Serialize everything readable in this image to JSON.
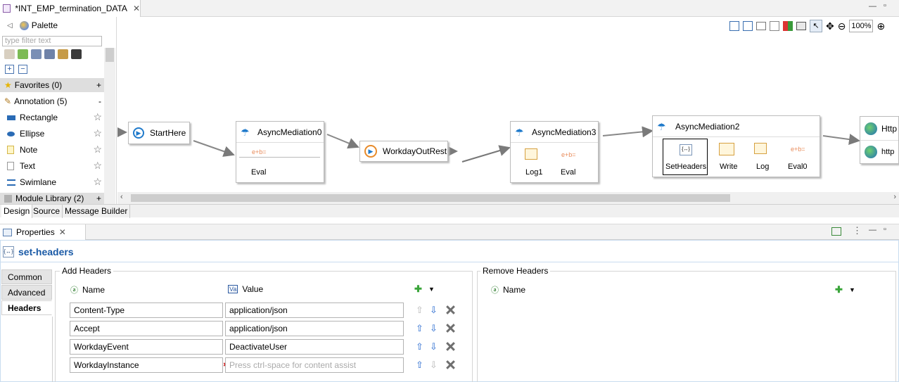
{
  "editor": {
    "tab_title": "*INT_EMP_termination_DATA",
    "tab_close": "✕",
    "minimize": "—",
    "maximize": "▫"
  },
  "palette": {
    "title": "Palette",
    "filter_placeholder": "type filter text",
    "sections": {
      "favorites": {
        "label": "Favorites (0)",
        "toggle": "+"
      },
      "annotation": {
        "label": "Annotation (5)",
        "toggle": "-"
      },
      "module_library": {
        "label": "Module Library (2)",
        "toggle": "+"
      }
    },
    "items": [
      {
        "label": "Rectangle",
        "icon": "rectangle-icon"
      },
      {
        "label": "Ellipse",
        "icon": "ellipse-icon"
      },
      {
        "label": "Note",
        "icon": "note-icon"
      },
      {
        "label": "Text",
        "icon": "text-icon"
      },
      {
        "label": "Swimlane",
        "icon": "swimlane-icon"
      }
    ],
    "star": "☆"
  },
  "toolbar": {
    "zoom": "100%"
  },
  "canvas": {
    "nodes": {
      "start": "StartHere",
      "am0": {
        "title": "AsyncMediation0",
        "steps": [
          "Eval"
        ]
      },
      "workday_out": "WorkdayOutRest",
      "am3": {
        "title": "AsyncMediation3",
        "steps": [
          "Log1",
          "Eval"
        ]
      },
      "am2": {
        "title": "AsyncMediation2",
        "steps": [
          "SetHeaders",
          "Write",
          "Log",
          "Eval0"
        ]
      },
      "http1": "Http",
      "http2": "http"
    },
    "colors": {
      "accent": "#1f7acb",
      "eval": "#e88b5a"
    }
  },
  "bottom_tabs": [
    "Design",
    "Source",
    "Message Builder"
  ],
  "properties": {
    "tab_title": "Properties",
    "tab_close": "✕",
    "title": "set-headers",
    "side_tabs": [
      "Common",
      "Advanced",
      "Headers"
    ],
    "add_headers": {
      "label": "Add Headers",
      "col_name": "Name",
      "col_value": "Value",
      "rows": [
        {
          "name": "Content-Type",
          "value": "application/json"
        },
        {
          "name": "Accept",
          "value": "application/json"
        },
        {
          "name": "WorkdayEvent",
          "value": "DeactivateUser"
        },
        {
          "name": "WorkdayInstance",
          "value": "",
          "placeholder": "Press ctrl-space for content assist"
        }
      ]
    },
    "remove_headers": {
      "label": "Remove Headers",
      "col_name": "Name"
    }
  }
}
